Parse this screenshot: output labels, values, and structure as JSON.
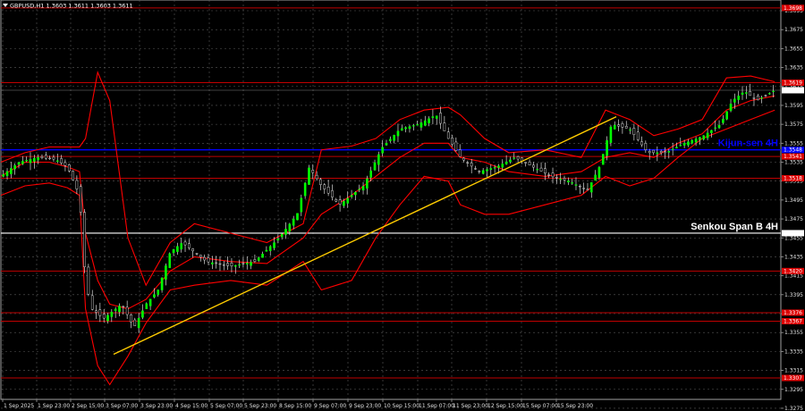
{
  "header": {
    "symbol": "GBPUSD,H1",
    "ohlc": "1.3603 1.3611 1.3603 1.3611"
  },
  "chart_data": {
    "type": "candlestick",
    "xlabel": "",
    "ylabel": "",
    "ylim": [
      1.3265,
      1.3705
    ],
    "grid": true,
    "background": "#000000",
    "colors": {
      "bull": "#00ff00",
      "bear": "#000000",
      "wick": "#ffffff",
      "bollinger": "#ff0000",
      "level": "#c00000",
      "kijun": "#0000ff",
      "senkou": "#ffffff",
      "trendline": "#ffcc00"
    },
    "y_ticks": [
      "1.3695",
      "1.3675",
      "1.3655",
      "1.3635",
      "1.3615",
      "1.3595",
      "1.3575",
      "1.3555",
      "1.3535",
      "1.3515",
      "1.3495",
      "1.3475",
      "1.3455",
      "1.3435",
      "1.3415",
      "1.3395",
      "1.3375",
      "1.3355",
      "1.3335",
      "1.3315",
      "1.3295",
      "1.3275"
    ],
    "x_ticks": [
      "1 Sep 2025",
      "1 Sep 23:00",
      "2 Sep 15:00",
      "3 Sep 07:00",
      "3 Sep 23:00",
      "4 Sep 15:00",
      "5 Sep 07:00",
      "5 Sep 23:00",
      "8 Sep 15:00",
      "9 Sep 07:00",
      "9 Sep 23:00",
      "10 Sep 15:00",
      "11 Sep 07:00",
      "11 Sep 23:00",
      "12 Sep 15:00",
      "15 Sep 07:00",
      "15 Sep 23:00"
    ],
    "horizontal_levels": [
      {
        "value": 1.3698,
        "label": "1.3698",
        "kind": "resistance"
      },
      {
        "value": 1.3619,
        "label": "1.3619",
        "kind": "resistance"
      },
      {
        "value": 1.3548,
        "label": "1.3548",
        "kind": "kijun"
      },
      {
        "value": 1.3541,
        "label": "1.3541",
        "kind": "resistance"
      },
      {
        "value": 1.3518,
        "label": "1.3518",
        "kind": "resistance"
      },
      {
        "value": 1.346,
        "label": "1.3460",
        "kind": "senkou"
      },
      {
        "value": 1.342,
        "label": "1.3420",
        "kind": "resistance"
      },
      {
        "value": 1.3376,
        "label": "1.3376",
        "kind": "resistance"
      },
      {
        "value": 1.3367,
        "label": "1.3367",
        "kind": "resistance"
      },
      {
        "value": 1.3307,
        "label": "1.3307",
        "kind": "resistance"
      }
    ],
    "current_price": {
      "value": 1.3611,
      "label": "1.3611"
    },
    "annotations": [
      {
        "text": "Kijun-sen 4H",
        "level": 1.3548,
        "color": "#0000ff"
      },
      {
        "text": "Senkou Span B 4H",
        "level": 1.346,
        "color": "#ffffff"
      }
    ],
    "trendline": {
      "from": {
        "x": "3 Sep 07:00",
        "y": 1.3332
      },
      "to": {
        "x": "16 Sep",
        "y": 1.3583
      }
    },
    "bollinger": {
      "x": [
        0,
        20,
        40,
        55,
        65,
        70,
        80,
        90,
        105,
        120,
        140,
        160,
        190,
        220,
        250,
        265,
        290,
        310,
        330,
        350,
        370,
        380,
        400,
        420,
        450,
        480,
        500,
        520,
        540,
        560,
        580,
        600,
        620,
        640
      ],
      "upper": [
        1.3535,
        1.3545,
        1.3551,
        1.3551,
        1.3551,
        1.356,
        1.363,
        1.36,
        1.3455,
        1.3405,
        1.345,
        1.347,
        1.346,
        1.345,
        1.347,
        1.3548,
        1.3552,
        1.356,
        1.358,
        1.359,
        1.3593,
        1.3585,
        1.356,
        1.3545,
        1.3548,
        1.354,
        1.359,
        1.358,
        1.3563,
        1.357,
        1.358,
        1.3624,
        1.3626,
        1.362
      ],
      "middle": [
        1.352,
        1.3535,
        1.3535,
        1.353,
        1.3525,
        1.346,
        1.341,
        1.3385,
        1.338,
        1.339,
        1.342,
        1.3435,
        1.343,
        1.3428,
        1.3455,
        1.348,
        1.35,
        1.352,
        1.354,
        1.3555,
        1.3555,
        1.354,
        1.3535,
        1.3525,
        1.352,
        1.3525,
        1.354,
        1.3545,
        1.354,
        1.3555,
        1.3565,
        1.359,
        1.36,
        1.3605
      ],
      "lower": [
        1.35,
        1.351,
        1.3513,
        1.3508,
        1.35,
        1.338,
        1.332,
        1.33,
        1.333,
        1.3365,
        1.34,
        1.3405,
        1.341,
        1.3405,
        1.343,
        1.34,
        1.341,
        1.3455,
        1.349,
        1.352,
        1.3515,
        1.349,
        1.348,
        1.348,
        1.349,
        1.35,
        1.352,
        1.351,
        1.3518,
        1.354,
        1.356,
        1.357,
        1.358,
        1.359
      ]
    },
    "close_path": {
      "x": [
        0,
        15,
        30,
        45,
        55,
        65,
        70,
        75,
        85,
        100,
        110,
        120,
        130,
        140,
        150,
        170,
        190,
        210,
        230,
        245,
        255,
        265,
        280,
        300,
        315,
        330,
        345,
        360,
        370,
        380,
        395,
        410,
        425,
        440,
        455,
        470,
        485,
        495,
        505,
        520,
        535,
        550,
        565,
        580,
        595,
        605,
        615,
        625,
        640
      ],
      "y": [
        1.352,
        1.3535,
        1.354,
        1.3538,
        1.353,
        1.35,
        1.341,
        1.338,
        1.337,
        1.3385,
        1.336,
        1.3385,
        1.34,
        1.344,
        1.345,
        1.343,
        1.3425,
        1.343,
        1.3455,
        1.348,
        1.353,
        1.351,
        1.349,
        1.351,
        1.355,
        1.357,
        1.3575,
        1.3585,
        1.356,
        1.354,
        1.3525,
        1.353,
        1.354,
        1.353,
        1.352,
        1.3515,
        1.3505,
        1.353,
        1.3575,
        1.357,
        1.3545,
        1.3545,
        1.3555,
        1.3562,
        1.3575,
        1.36,
        1.361,
        1.36,
        1.3611
      ]
    }
  }
}
